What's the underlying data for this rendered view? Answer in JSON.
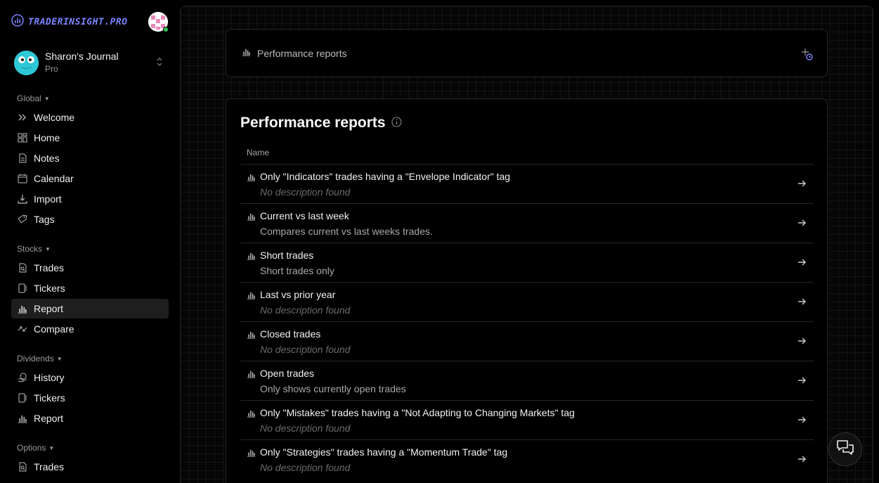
{
  "brand": {
    "name": "TRADERINSIGHT.PRO",
    "logo_icon": "bar-chart-icon",
    "accent": "#7b83ff"
  },
  "journal": {
    "name": "Sharon's Journal",
    "plan": "Pro",
    "avatar_color": "#2ec7d6"
  },
  "sidebar": {
    "global": {
      "label": "Global",
      "items": [
        {
          "label": "Welcome",
          "icon": "chevrons-right-icon"
        },
        {
          "label": "Home",
          "icon": "dashboard-icon"
        },
        {
          "label": "Notes",
          "icon": "document-icon"
        },
        {
          "label": "Calendar",
          "icon": "calendar-icon"
        },
        {
          "label": "Import",
          "icon": "download-icon"
        },
        {
          "label": "Tags",
          "icon": "tag-icon"
        }
      ]
    },
    "stocks": {
      "label": "Stocks",
      "items": [
        {
          "label": "Trades",
          "icon": "file-search-icon"
        },
        {
          "label": "Tickers",
          "icon": "ticker-icon"
        },
        {
          "label": "Report",
          "icon": "bar-chart-icon",
          "active": true
        },
        {
          "label": "Compare",
          "icon": "compare-arrows-icon"
        }
      ]
    },
    "dividends": {
      "label": "Dividends",
      "items": [
        {
          "label": "History",
          "icon": "coins-icon"
        },
        {
          "label": "Tickers",
          "icon": "ticker-icon"
        },
        {
          "label": "Report",
          "icon": "bar-chart-icon"
        }
      ]
    },
    "options": {
      "label": "Options",
      "items": [
        {
          "label": "Trades",
          "icon": "file-search-icon"
        }
      ]
    }
  },
  "header": {
    "title": "Performance reports"
  },
  "reports": {
    "title": "Performance reports",
    "column_name": "Name",
    "rows": [
      {
        "name": "Only \"Indicators\" trades having a \"Envelope Indicator\" tag",
        "description": "No description found",
        "empty": true
      },
      {
        "name": "Current vs last week",
        "description": "Compares current vs last weeks trades.",
        "empty": false
      },
      {
        "name": "Short trades",
        "description": "Short trades only",
        "empty": false
      },
      {
        "name": "Last vs prior year",
        "description": "No description found",
        "empty": true
      },
      {
        "name": "Closed trades",
        "description": "No description found",
        "empty": true
      },
      {
        "name": "Open trades",
        "description": "Only shows currently open trades",
        "empty": false
      },
      {
        "name": "Only \"Mistakes\" trades having a \"Not Adapting to Changing Markets\" tag",
        "description": "No description found",
        "empty": true
      },
      {
        "name": "Only \"Strategies\" trades having a \"Momentum Trade\" tag",
        "description": "No description found",
        "empty": true
      }
    ]
  }
}
